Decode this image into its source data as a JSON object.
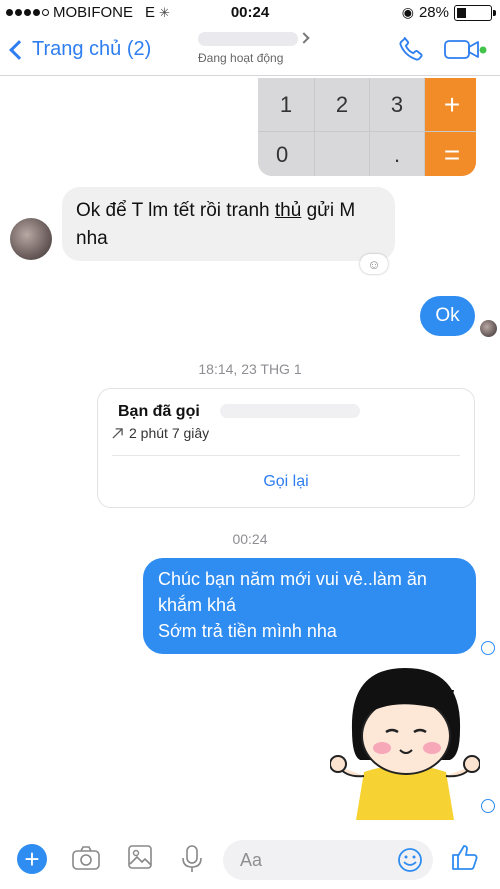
{
  "status_bar": {
    "carrier": "MOBIFONE",
    "network": "E",
    "time": "00:24",
    "battery": "28%",
    "battery_level": 0.28
  },
  "header": {
    "back_label": "Trang chủ (2)",
    "subtitle": "Đang hoạt động"
  },
  "calculator_keys": [
    "1",
    "2",
    "3",
    "+",
    "0",
    "",
    ".",
    "="
  ],
  "messages": {
    "incoming_1_a": "Ok để T lm tết rồi tranh ",
    "incoming_1_underlined": "thủ",
    "incoming_1_b": " gửi M nha",
    "outgoing_1": "Ok",
    "timestamp_1": "18:14, 23 THG 1",
    "call_title": "Bạn đã gọi",
    "call_duration": "2 phút 7 giây",
    "call_again": "Gọi lại",
    "timestamp_2": "00:24",
    "outgoing_2_line1": "Chúc bạn năm mới vui vẻ..làm ăn",
    "outgoing_2_line2": "khắm khá",
    "outgoing_2_line3": "Sớm trả tiền mình nha"
  },
  "composer": {
    "placeholder": "Aa"
  },
  "colors": {
    "accent": "#2f8cf0",
    "calc_operator": "#f28c28",
    "incoming_bubble": "#f1f0f0"
  }
}
